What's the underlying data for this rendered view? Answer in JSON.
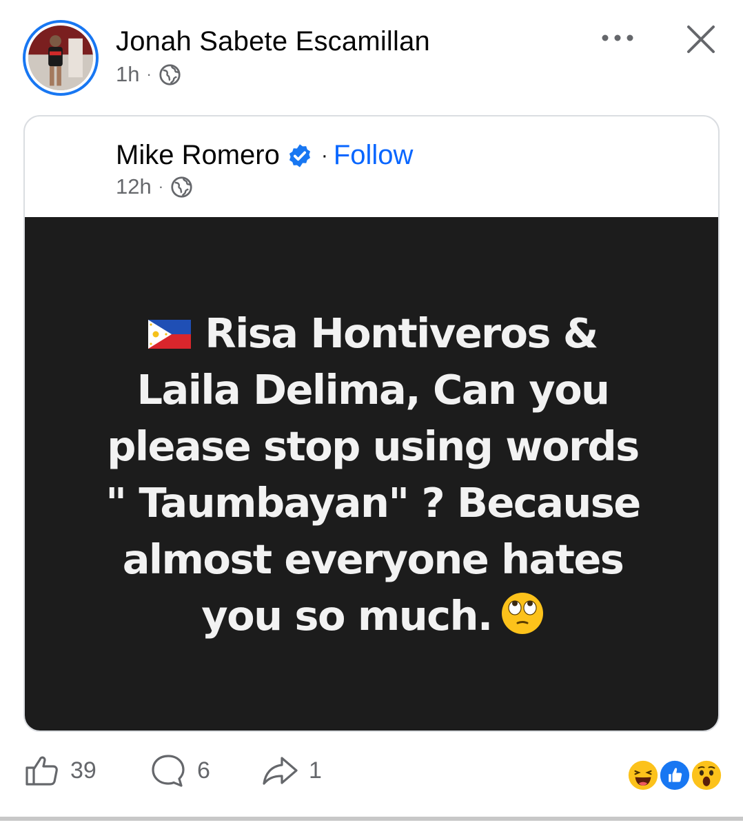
{
  "post": {
    "author": "Jonah Sabete Escamillan",
    "time": "1h",
    "separator": "·"
  },
  "shared": {
    "author": "Mike Romero",
    "verified": true,
    "separator": "·",
    "follow_label": "Follow",
    "time": "12h",
    "image_lines": [
      "Risa Hontiveros &",
      "Laila Delima, Can you",
      "please stop using words",
      "\" Taumbayan\" ? Because",
      "almost everyone hates",
      "you so much."
    ]
  },
  "actions": {
    "like_count": "39",
    "comment_count": "6",
    "share_count": "1"
  },
  "reactions": [
    "haha-emoji",
    "like-emoji",
    "wow-emoji"
  ],
  "icons": [
    "globe-icon",
    "more-options-icon",
    "close-icon",
    "verified-badge-icon",
    "like-icon",
    "comment-icon",
    "share-icon",
    "philippine-flag-emoji",
    "face-with-rolling-eyes-emoji"
  ],
  "colors": {
    "accent": "#1877f2",
    "follow": "#0866ff",
    "image_bg": "#1c1c1c",
    "secondary_text": "#65676b"
  }
}
